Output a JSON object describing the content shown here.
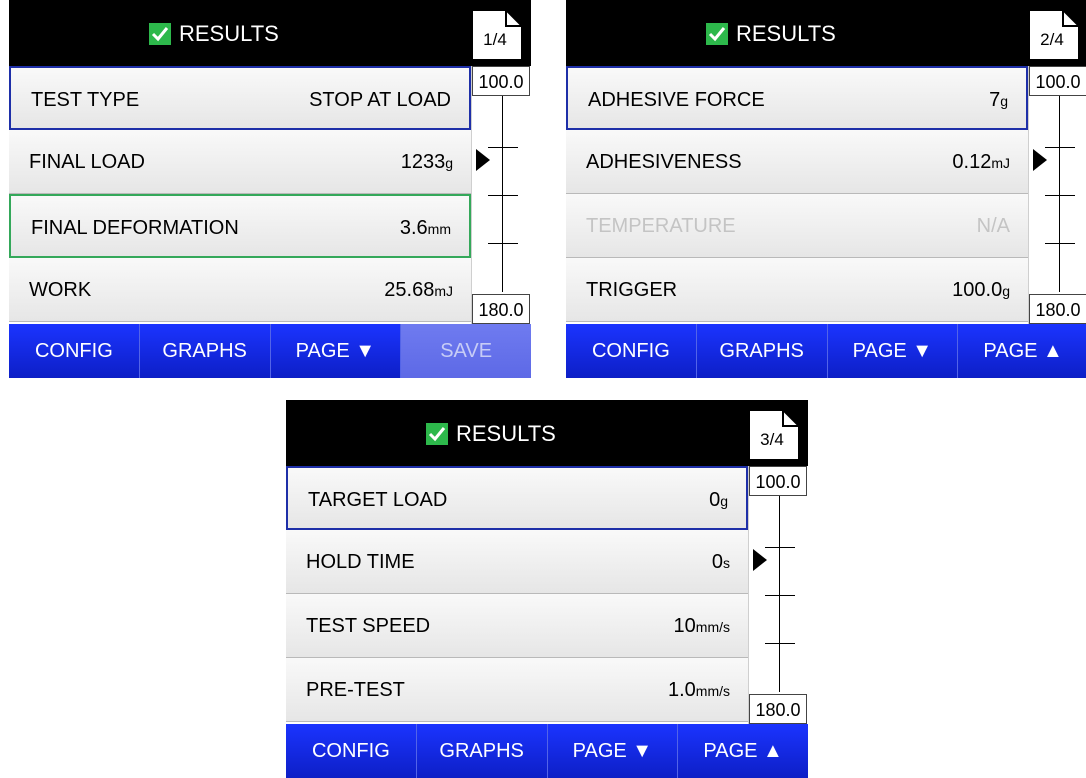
{
  "header_title": "RESULTS",
  "scroll": {
    "top_label": "100.0",
    "bottom_label": "180.0"
  },
  "screens": [
    {
      "page_indicator": "1/4",
      "rows": [
        {
          "label": "TEST TYPE",
          "value": "STOP AT LOAD",
          "unit": ""
        },
        {
          "label": "FINAL LOAD",
          "value": "1233",
          "unit": "g"
        },
        {
          "label": "FINAL DEFORMATION",
          "value": "3.6",
          "unit": "mm"
        },
        {
          "label": "WORK",
          "value": "25.68",
          "unit": "mJ"
        }
      ],
      "buttons": [
        "CONFIG",
        "GRAPHS",
        "PAGE ▼",
        "SAVE"
      ]
    },
    {
      "page_indicator": "2/4",
      "rows": [
        {
          "label": "ADHESIVE FORCE",
          "value": "7",
          "unit": "g"
        },
        {
          "label": "ADHESIVENESS",
          "value": "0.12",
          "unit": "mJ"
        },
        {
          "label": "TEMPERATURE",
          "value": "N/A",
          "unit": ""
        },
        {
          "label": "TRIGGER",
          "value": "100.0",
          "unit": "g"
        }
      ],
      "buttons": [
        "CONFIG",
        "GRAPHS",
        "PAGE ▼",
        "PAGE ▲"
      ]
    },
    {
      "page_indicator": "3/4",
      "rows": [
        {
          "label": "TARGET LOAD",
          "value": "0",
          "unit": "g"
        },
        {
          "label": "HOLD TIME",
          "value": "0",
          "unit": "s"
        },
        {
          "label": "TEST SPEED",
          "value": "10",
          "unit": "mm/s"
        },
        {
          "label": "PRE-TEST",
          "value": "1.0",
          "unit": "mm/s"
        }
      ],
      "buttons": [
        "CONFIG",
        "GRAPHS",
        "PAGE ▼",
        "PAGE ▲"
      ]
    }
  ],
  "icons": {
    "header": "checkmark-icon",
    "page": "document-page-icon",
    "scroll_pointer": "triangle-pointer-icon"
  },
  "colors": {
    "header_bg": "#000000",
    "check": "#2db84b",
    "button": "#1b34ff",
    "button_disabled": "#6f7bf0",
    "select_blue": "#1e2fa8",
    "select_green": "#34a85a"
  }
}
